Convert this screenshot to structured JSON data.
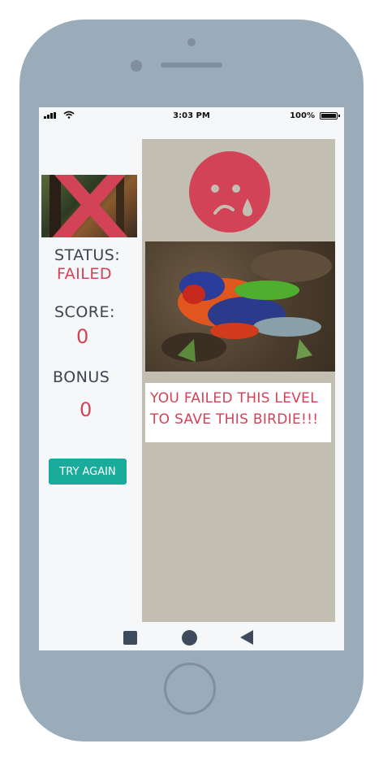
{
  "status_bar": {
    "time": "3:03 PM",
    "battery_pct": "100%"
  },
  "left": {
    "status_label": "STATUS:",
    "status_value": "FAILED",
    "score_label": "SCORE:",
    "score_value": "0",
    "bonus_label": "BONUS",
    "bonus_value": "0",
    "try_again_label": "TRY AGAIN"
  },
  "right": {
    "message": "YOU FAILED THIS LEVEL TO SAVE THIS BIRDIE!!!"
  },
  "colors": {
    "accent_red": "#d24357",
    "teal": "#1aab9b",
    "panel_bg": "#c3beb2",
    "phone_body": "#9aabb9"
  },
  "icons": [
    "signal-icon",
    "wifi-icon",
    "battery-icon",
    "fail-cross-icon",
    "sad-face-icon",
    "nav-square-icon",
    "nav-circle-icon",
    "nav-back-icon"
  ]
}
